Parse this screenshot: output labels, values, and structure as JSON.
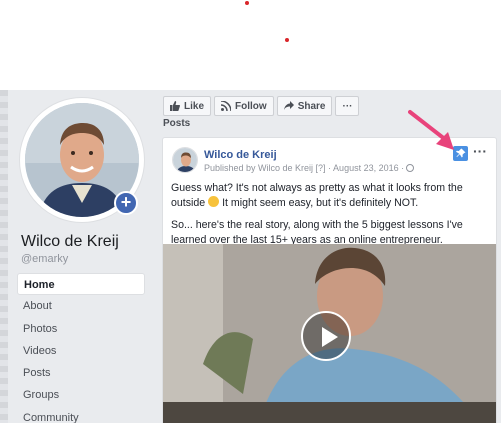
{
  "profile": {
    "name": "Wilco de Kreij",
    "handle": "@emarky",
    "add_label": "+"
  },
  "nav": {
    "items": [
      "Home",
      "About",
      "Photos",
      "Videos",
      "Posts",
      "Groups",
      "Community"
    ],
    "active": "Home"
  },
  "actions": {
    "like": "Like",
    "follow": "Follow",
    "share": "Share",
    "more": "···"
  },
  "section": {
    "title": "Posts"
  },
  "post": {
    "author": "Wilco de Kreij",
    "meta": "Published by Wilco de Kreij [?] · August 23, 2016 ·",
    "more": "···",
    "paragraph1_before": "Guess what? It's not always as pretty as what it looks from the outside",
    "paragraph1_after": "It might seem easy, but it's definitely NOT.",
    "paragraph2": "So... here's the real story, along with the 5 biggest lessons I've learned over the last 15+ years as an online entrepreneur."
  },
  "colors": {
    "link": "#365899",
    "pin_button": "#4a90e2",
    "annotation_arrow": "#e8437b",
    "page_bg": "#e9ebee"
  },
  "icons": [
    "like-icon",
    "follow-icon",
    "share-icon",
    "pin-icon",
    "play-icon",
    "globe-icon"
  ]
}
